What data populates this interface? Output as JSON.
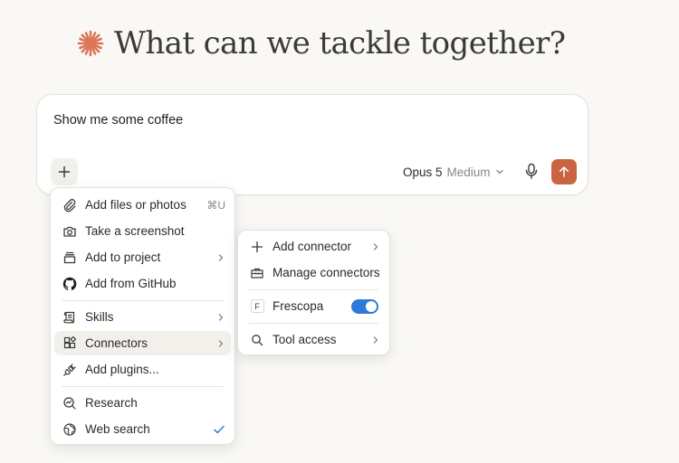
{
  "headline": {
    "text": "What can we tackle together?"
  },
  "composer": {
    "prompt_text": "Show me some coffee",
    "model_name": "Opus 5",
    "effort": "Medium"
  },
  "add_menu": {
    "items": [
      {
        "label": "Add files or photos",
        "shortcut": "⌘U",
        "icon": "paperclip-icon"
      },
      {
        "label": "Take a screenshot",
        "icon": "camera-icon"
      },
      {
        "label": "Add to project",
        "icon": "project-box-icon",
        "submenu": true
      },
      {
        "label": "Add from GitHub",
        "icon": "github-icon"
      },
      {
        "label": "Skills",
        "icon": "scroll-icon",
        "submenu": true
      },
      {
        "label": "Connectors",
        "icon": "connectors-icon",
        "submenu": true,
        "active": true
      },
      {
        "label": "Add plugins...",
        "icon": "plug-icon"
      },
      {
        "label": "Research",
        "icon": "research-icon"
      },
      {
        "label": "Web search",
        "icon": "globe-icon",
        "checked": true
      }
    ]
  },
  "connectors_menu": {
    "items": [
      {
        "label": "Add connector",
        "icon": "plus-icon",
        "submenu": true
      },
      {
        "label": "Manage connectors",
        "icon": "toolbox-icon"
      },
      {
        "label": "Frescopa",
        "badge": "F",
        "toggle_on": true
      },
      {
        "label": "Tool access",
        "icon": "search-icon",
        "submenu": true
      }
    ]
  },
  "colors": {
    "accent": "#c96442",
    "toggle": "#2f7ad8",
    "check": "#2f7ad8",
    "background": "#f9f8f5"
  }
}
